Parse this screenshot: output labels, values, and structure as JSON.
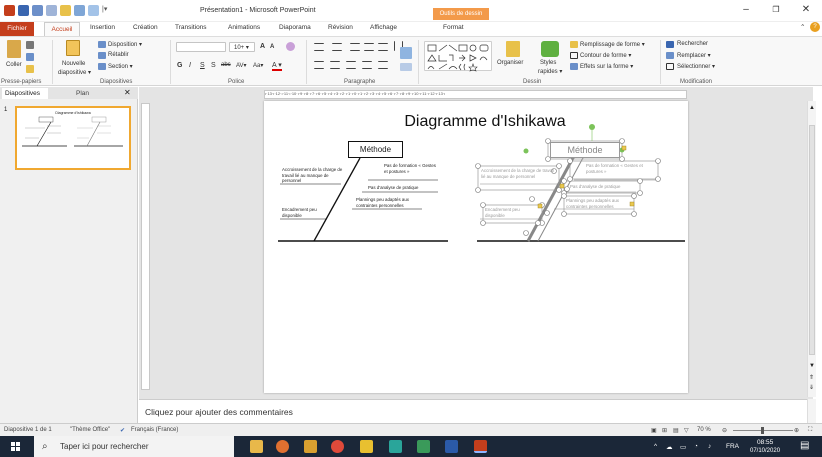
{
  "window": {
    "title": "Présentation1 - Microsoft PowerPoint",
    "context_tab_group": "Outils de dessin",
    "controls": {
      "minimize": "–",
      "maximize": "❐",
      "close": "✕"
    }
  },
  "ribbon_tabs": [
    "Fichier",
    "Accueil",
    "Insertion",
    "Création",
    "Transitions",
    "Animations",
    "Diaporama",
    "Révision",
    "Affichage",
    "Format"
  ],
  "ribbon": {
    "presse_papiers": {
      "label": "Presse-papiers",
      "coller": "Coller"
    },
    "diapositives": {
      "label": "Diapositives",
      "nouvelle": "Nouvelle",
      "nouvelle2": "diapositive ▾",
      "disposition": "Disposition ▾",
      "retablir": "Rétablir",
      "section": "Section ▾"
    },
    "police": {
      "label": "Police",
      "size": "10+ ▾",
      "bold": "G",
      "italic": "I",
      "underline": "S",
      "shadow": "S",
      "strike": "abc",
      "spacing": "AV▾",
      "case": "Aa▾",
      "color": "A ▾",
      "grow": "A",
      "shrink": "A"
    },
    "paragraphe": {
      "label": "Paragraphe"
    },
    "dessin": {
      "label": "Dessin",
      "organiser": "Organiser",
      "styles": "Styles",
      "styles2": "rapides ▾",
      "remplissage": "Remplissage de forme ▾",
      "contour": "Contour de forme ▾",
      "effets": "Effets sur la forme ▾"
    },
    "modification": {
      "label": "Modification",
      "rechercher": "Rechercher",
      "remplacer": "Remplacer ▾",
      "selectionner": "Sélectionner ▾"
    }
  },
  "left_panel": {
    "tab_slides": "Diapositives",
    "tab_plan": "Plan",
    "close": "✕",
    "slide_number": "1",
    "thumb_title": "Diagramme d'Ishikawa"
  },
  "ruler_text": "ı·13·ı·12·ı·11·ı·10·ı·9·ı·8·ı·7·ı·6·ı·5·ı·4·ı·3·ı·2·ı·1·ı·0·ı·1·ı·2·ı·3·ı·4·ı·5·ı·6·ı·7·ı·8·ı·9·ı·10·ı·11·ı·12·ı·13·ı",
  "slide": {
    "title": "Diagramme d'Ishikawa",
    "methode": "Méthode",
    "labels": {
      "accroissement": "Accroissement de la charge de travail lié au manque de personnel",
      "formation": "Pas de formation « Gestes et postures »",
      "analyse": "Pas d'analyse de pratique",
      "plannings": "Plannings peu adaptés aux contraintes personnelles",
      "encadrement": "Encadrement peu disponible"
    }
  },
  "notes": {
    "placeholder": "Cliquez pour ajouter des commentaires"
  },
  "status": {
    "slide": "Diapositive 1 de 1",
    "theme": "\"Thème Office\"",
    "language": "Français (France)",
    "zoom": "70 %"
  },
  "taskbar": {
    "search_placeholder": "Taper ici pour rechercher",
    "lang": "FRA",
    "time": "08:55",
    "date": "07/10/2020"
  },
  "colors": {
    "accent": "#c43e1c",
    "context": "#f39a4a",
    "taskbar": "#1b2738"
  }
}
